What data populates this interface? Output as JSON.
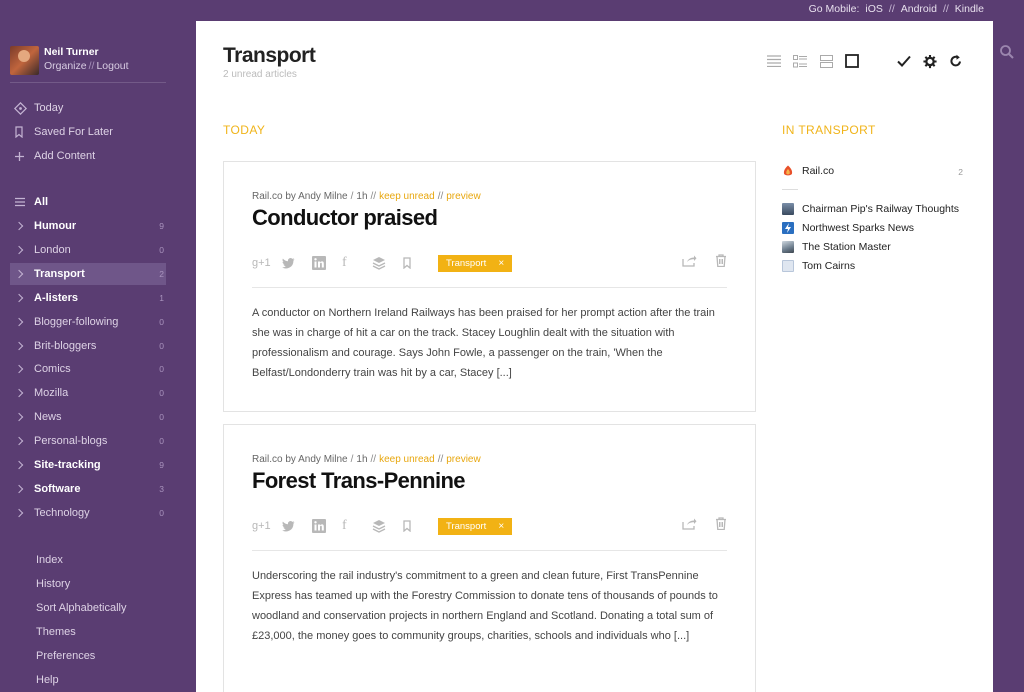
{
  "topbar": {
    "label": "Go Mobile:",
    "ios": "iOS",
    "android": "Android",
    "kindle": "Kindle",
    "sep": "//"
  },
  "user": {
    "name": "Neil Turner",
    "organize": "Organize",
    "logout": "Logout",
    "sep": "//"
  },
  "nav_top": [
    {
      "label": "Today",
      "icon": "today-icon"
    },
    {
      "label": "Saved For Later",
      "icon": "bookmark-icon"
    },
    {
      "label": "Add Content",
      "icon": "plus-icon"
    }
  ],
  "nav_all": {
    "label": "All"
  },
  "categories": [
    {
      "label": "Humour",
      "count": "9",
      "bold": true
    },
    {
      "label": "London",
      "count": "0",
      "bold": false
    },
    {
      "label": "Transport",
      "count": "2",
      "bold": true,
      "active": true
    },
    {
      "label": "A-listers",
      "count": "1",
      "bold": true
    },
    {
      "label": "Blogger-following",
      "count": "0",
      "bold": false
    },
    {
      "label": "Brit-bloggers",
      "count": "0",
      "bold": false
    },
    {
      "label": "Comics",
      "count": "0",
      "bold": false
    },
    {
      "label": "Mozilla",
      "count": "0",
      "bold": false
    },
    {
      "label": "News",
      "count": "0",
      "bold": false
    },
    {
      "label": "Personal-blogs",
      "count": "0",
      "bold": false
    },
    {
      "label": "Site-tracking",
      "count": "9",
      "bold": true
    },
    {
      "label": "Software",
      "count": "3",
      "bold": true
    },
    {
      "label": "Technology",
      "count": "0",
      "bold": false
    }
  ],
  "bottom_links": [
    "Index",
    "History",
    "Sort Alphabetically",
    "Themes",
    "Preferences",
    "Help"
  ],
  "main": {
    "title": "Transport",
    "subtitle": "2 unread articles",
    "today_label": "TODAY",
    "in_label": "IN TRANSPORT"
  },
  "articles": [
    {
      "source": "Rail.co by Andy Milne",
      "age": "1h",
      "keep_unread": "keep unread",
      "preview": "preview",
      "title": "Conductor praised",
      "tag": "Transport",
      "tag_close": "×",
      "gplus": "g+1",
      "summary": "A conductor on Northern Ireland Railways has been praised for her prompt action after the train she was in charge of hit a car on the track. Stacey Loughlin dealt with the situation with professionalism and courage. Says John Fowle, a passenger on the train, 'When the Belfast/Londonderry train was hit by a car, Stacey [...]"
    },
    {
      "source": "Rail.co by Andy Milne",
      "age": "1h",
      "keep_unread": "keep unread",
      "preview": "preview",
      "title": "Forest Trans-Pennine",
      "tag": "Transport",
      "tag_close": "×",
      "gplus": "g+1",
      "summary": "Underscoring the rail industry's commitment to a green and clean future, First TransPennine Express has teamed up with the Forestry Commission to donate tens of thousands of pounds to woodland and conservation projects in northern England and Scotland. Donating a total sum of £23,000, the money goes to community groups, charities, schools and individuals who [...]"
    }
  ],
  "sources": {
    "top": {
      "label": "Rail.co",
      "count": "2"
    },
    "list": [
      "Chairman Pip's Railway Thoughts",
      "Northwest Sparks News",
      "The Station Master",
      "Tom Cairns"
    ]
  },
  "colors": {
    "sidebar": "#5a3d72",
    "accent": "#f0b41a",
    "tag": "#f2b214"
  }
}
